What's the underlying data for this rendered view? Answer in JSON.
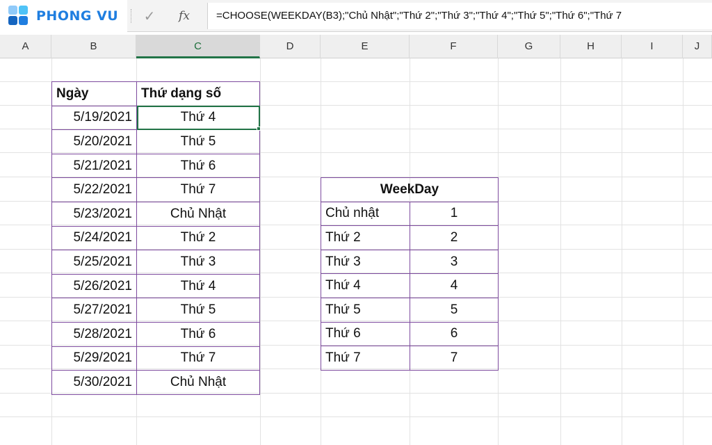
{
  "brand": {
    "name": "PHONG VU",
    "colors": [
      "#4fc3f7",
      "#1f7ee0",
      "#1565c0",
      "#90caf9"
    ]
  },
  "formula_bar": {
    "check_icon": "✓",
    "fx_icon": "fx",
    "formula": "=CHOOSE(WEEKDAY(B3);\"Chủ Nhật\";\"Thứ 2\";\"Thứ 3\";\"Thứ 4\";\"Thứ 5\";\"Thứ 6\";\"Thứ 7"
  },
  "columns": [
    "A",
    "B",
    "C",
    "D",
    "E",
    "F",
    "G",
    "H",
    "I",
    "J"
  ],
  "active_column": "C",
  "accent_color": "#217346",
  "table_border_color": "#7d4a9e",
  "date_table": {
    "headers": [
      "Ngày",
      "Thứ dạng số"
    ],
    "rows": [
      [
        "5/19/2021",
        "Thứ 4"
      ],
      [
        "5/20/2021",
        "Thứ 5"
      ],
      [
        "5/21/2021",
        "Thứ 6"
      ],
      [
        "5/22/2021",
        "Thứ 7"
      ],
      [
        "5/23/2021",
        "Chủ Nhật"
      ],
      [
        "5/24/2021",
        "Thứ 2"
      ],
      [
        "5/25/2021",
        "Thứ 3"
      ],
      [
        "5/26/2021",
        "Thứ 4"
      ],
      [
        "5/27/2021",
        "Thứ 5"
      ],
      [
        "5/28/2021",
        "Thứ 6"
      ],
      [
        "5/29/2021",
        "Thứ 7"
      ],
      [
        "5/30/2021",
        "Chủ Nhật"
      ]
    ]
  },
  "weekday_table": {
    "title": "WeekDay",
    "rows": [
      [
        "Chủ nhật",
        "1"
      ],
      [
        "Thứ 2",
        "2"
      ],
      [
        "Thứ 3",
        "3"
      ],
      [
        "Thứ 4",
        "4"
      ],
      [
        "Thứ 5",
        "5"
      ],
      [
        "Thứ 6",
        "6"
      ],
      [
        "Thứ 7",
        "7"
      ]
    ]
  }
}
